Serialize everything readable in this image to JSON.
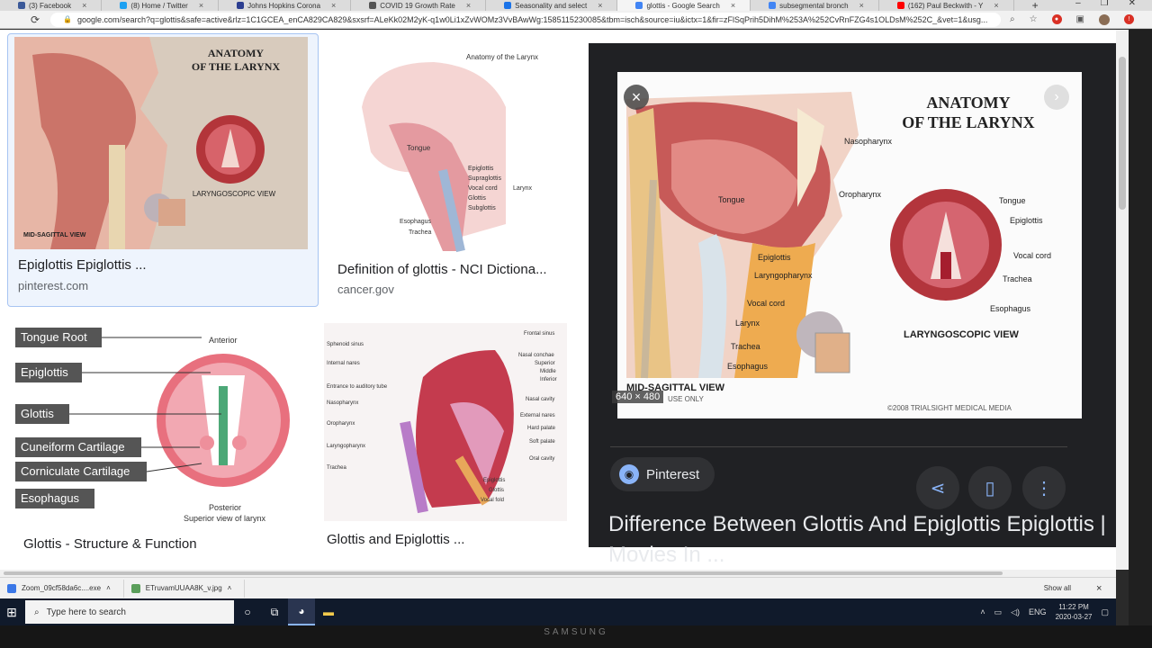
{
  "browser": {
    "tabs": [
      {
        "label": "(3) Facebook",
        "color": "#3b5998"
      },
      {
        "label": "(8) Home / Twitter",
        "color": "#1da1f2"
      },
      {
        "label": "Johns Hopkins Corona",
        "color": "#2c3e91"
      },
      {
        "label": "COVID 19 Growth Rate",
        "color": "#555555"
      },
      {
        "label": "Seasonality and select",
        "color": "#1a73e8"
      },
      {
        "label": "glottis - Google Search",
        "color": "#4285f4"
      },
      {
        "label": "subsegmental bronch",
        "color": "#4285f4"
      },
      {
        "label": "(162) Paul Beckwith - Y",
        "color": "#ff0000"
      }
    ],
    "active_tab": "glottis - Google Search",
    "url": "google.com/search?q=glottis&safe=active&rlz=1C1GCEA_enCA829CA829&sxsrf=ALeKk02M2yK-q1w0Li1xZvWOMz3VvBAwWg:1585115230085&tbm=isch&source=iu&ictx=1&fir=zFlSqPrih5DihM%253A%252CvRnFZG4s1OLDsM%252C_&vet=1&usg..."
  },
  "results": [
    {
      "title": "Epiglottis Epiglottis ...",
      "source": "pinterest.com"
    },
    {
      "title": "Definition of glottis - NCI Dictiona...",
      "source": "cancer.gov"
    },
    {
      "title": "Glottis - Structure & Function",
      "source": ""
    },
    {
      "title": "Glottis and Epiglottis ...",
      "source": ""
    }
  ],
  "thumb1": {
    "heading_line1": "ANATOMY",
    "heading_line2": "OF THE LARYNX",
    "view1": "MID-SAGITTAL VIEW",
    "view2": "LARYNGOSCOPIC VIEW"
  },
  "thumb2": {
    "heading": "Anatomy of the Larynx",
    "labels": [
      "Tongue",
      "Epiglottis",
      "Supraglottis",
      "Vocal cord",
      "Glottis",
      "Subglottis",
      "Larynx",
      "Esophagus",
      "Trachea"
    ]
  },
  "thumb3": {
    "labels": [
      "Tongue Root",
      "Epiglottis",
      "Glottis",
      "Cuneiform Cartilage",
      "Corniculate Cartilage",
      "Esophagus"
    ],
    "anterior": "Anterior",
    "posterior": "Posterior",
    "caption": "Superior view of larynx"
  },
  "thumb4": {
    "left_labels": [
      "Sphenoid sinus",
      "Internal nares",
      "Entrance to auditory tube",
      "Nasopharynx",
      "Oropharynx",
      "Laryngopharynx",
      "Trachea"
    ],
    "right_labels": [
      "Frontal sinus",
      "Nasal conchae",
      "Superior",
      "Middle",
      "Inferior",
      "Nasal cavity",
      "External nares",
      "Hard palate",
      "Soft palate",
      "Oral cavity",
      "Epiglottis",
      "Glottis",
      "Vocal fold"
    ]
  },
  "preview": {
    "heading_line1": "ANATOMY",
    "heading_line2": "OF THE LARYNX",
    "left_labels": [
      "Nasopharynx",
      "Oropharynx",
      "Tongue",
      "Epiglottis",
      "Laryngopharynx",
      "Vocal cord",
      "Larynx",
      "Trachea",
      "Esophagus"
    ],
    "right_labels": [
      "Tongue",
      "Epiglottis",
      "Vocal cord",
      "Trachea",
      "Esophagus"
    ],
    "view1": "MID-SAGITTAL VIEW",
    "view2": "LARYNGOSCOPIC VIEW",
    "usage": "USE ONLY",
    "copyright": "©2008 TRIALSIGHT MEDICAL MEDIA",
    "dimensions": "640 × 480",
    "source_name": "Pinterest",
    "title": "Difference Between Glottis And Epiglottis Epiglottis | Movies In ..."
  },
  "downloads": [
    {
      "name": "Zoom_09cf58da6c....exe"
    },
    {
      "name": "ETruvamUUAA8K_v.jpg"
    }
  ],
  "download_show_all": "Show all",
  "taskbar": {
    "search_placeholder": "Type here to search",
    "language": "ENG",
    "time": "11:22 PM",
    "date": "2020-03-27"
  },
  "monitor_brand": "SAMSUNG"
}
